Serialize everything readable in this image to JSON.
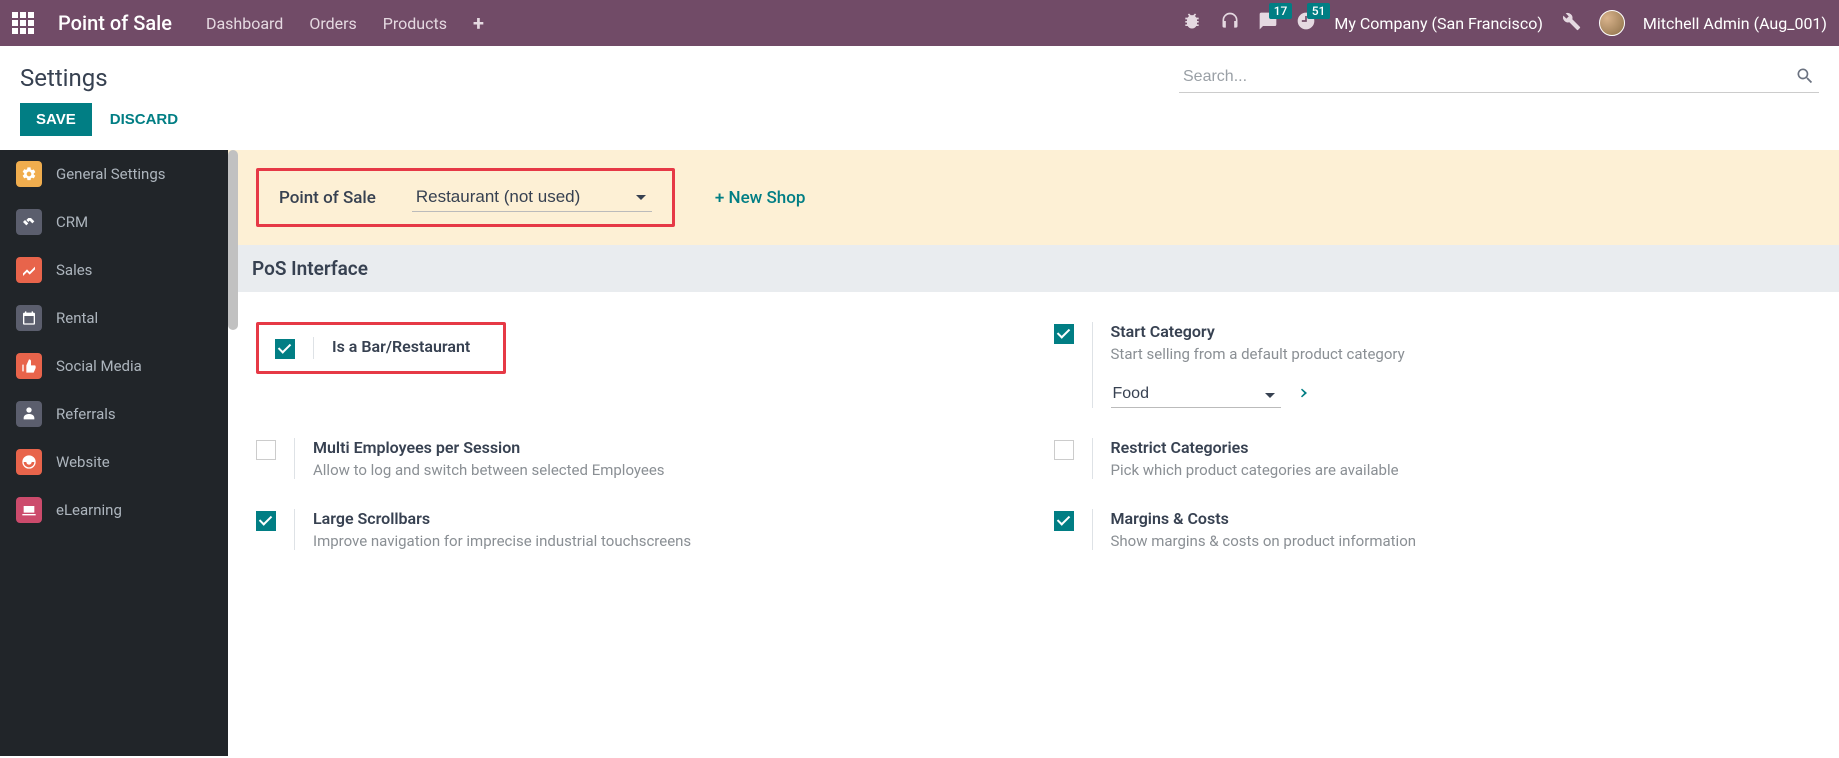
{
  "topnav": {
    "app_title": "Point of Sale",
    "links": [
      "Dashboard",
      "Orders",
      "Products"
    ],
    "msg_count": "17",
    "activity_count": "51",
    "company": "My Company (San Francisco)",
    "username": "Mitchell Admin (Aug_001)"
  },
  "control": {
    "page_title": "Settings",
    "search_placeholder": "Search...",
    "save": "SAVE",
    "discard": "DISCARD"
  },
  "sidebar": {
    "items": [
      {
        "label": "General Settings"
      },
      {
        "label": "CRM"
      },
      {
        "label": "Sales"
      },
      {
        "label": "Rental"
      },
      {
        "label": "Social Media"
      },
      {
        "label": "Referrals"
      },
      {
        "label": "Website"
      },
      {
        "label": "eLearning"
      }
    ]
  },
  "pos_header": {
    "label": "Point of Sale",
    "selected": "Restaurant (not used)",
    "new_shop": "+ New Shop"
  },
  "section": {
    "title": "PoS Interface"
  },
  "settings": {
    "bar_restaurant": {
      "title": "Is a Bar/Restaurant"
    },
    "start_category": {
      "title": "Start Category",
      "desc": "Start selling from a default product category",
      "value": "Food"
    },
    "multi_employees": {
      "title": "Multi Employees per Session",
      "desc": "Allow to log and switch between selected Employees"
    },
    "restrict_categories": {
      "title": "Restrict Categories",
      "desc": "Pick which product categories are available"
    },
    "large_scrollbars": {
      "title": "Large Scrollbars",
      "desc": "Improve navigation for imprecise industrial touchscreens"
    },
    "margins_costs": {
      "title": "Margins & Costs",
      "desc": "Show margins & costs on product information"
    }
  }
}
